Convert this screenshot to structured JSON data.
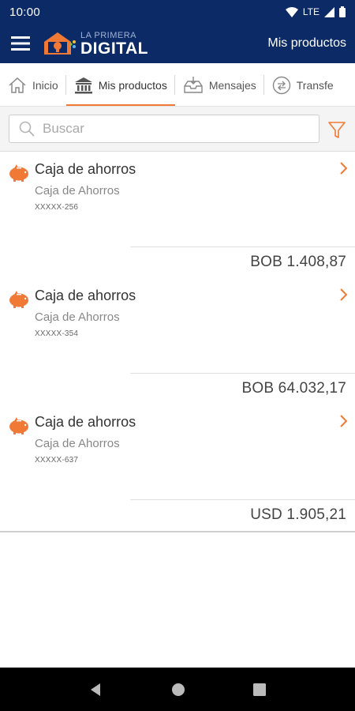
{
  "status_bar": {
    "time": "10:00",
    "network": "LTE"
  },
  "app_bar": {
    "logo_small": "LA PRIMERA",
    "logo_big": "DIGITAL",
    "title": "Mis productos"
  },
  "tabs": [
    {
      "label": "Inicio",
      "icon": "home-icon"
    },
    {
      "label": "Mis productos",
      "icon": "bank-icon",
      "active": true
    },
    {
      "label": "Mensajes",
      "icon": "inbox-icon"
    },
    {
      "label": "Transfe",
      "icon": "transfer-icon"
    }
  ],
  "search": {
    "placeholder": "Buscar",
    "value": ""
  },
  "products": [
    {
      "title": "Caja de ahorros",
      "subtitle": "Caja de Ahorros",
      "number": "XXXXX-256",
      "balance": "BOB 1.408,87"
    },
    {
      "title": "Caja de ahorros",
      "subtitle": "Caja de Ahorros",
      "number": "XXXXX-354",
      "balance": "BOB 64.032,17"
    },
    {
      "title": "Caja de ahorros",
      "subtitle": "Caja de Ahorros",
      "number": "XXXXX-637",
      "balance": "USD 1.905,21"
    }
  ],
  "colors": {
    "brand_navy": "#0b2a66",
    "accent_orange": "#f07a35"
  }
}
